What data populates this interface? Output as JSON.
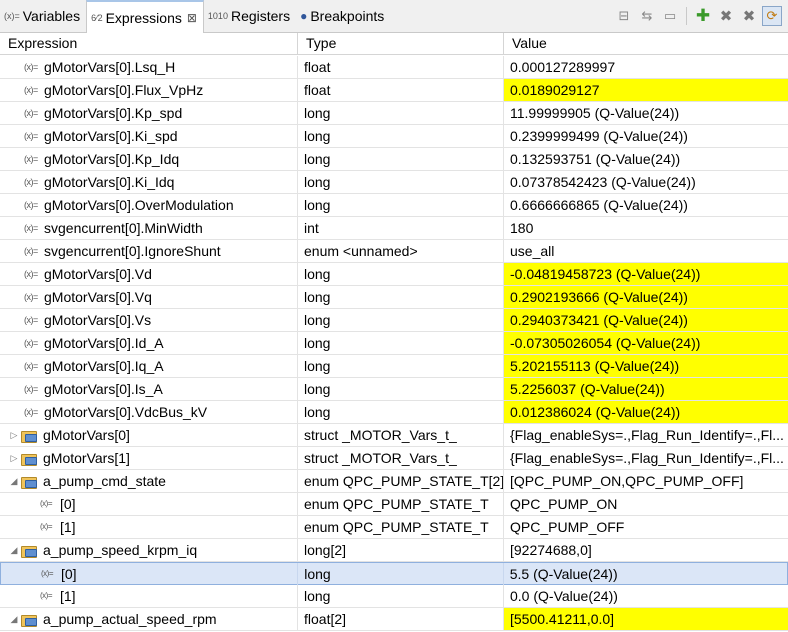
{
  "tabs": [
    {
      "label": "Variables",
      "icon": "variables-icon"
    },
    {
      "label": "Expressions",
      "icon": "expressions-icon",
      "active": true
    },
    {
      "label": "Registers",
      "icon": "registers-icon"
    },
    {
      "label": "Breakpoints",
      "icon": "breakpoints-icon"
    }
  ],
  "toolbar_icons": [
    "collapse-all-icon",
    "show-type-names-icon",
    "minimize-icon",
    "add-expression-icon",
    "remove-expression-icon",
    "remove-all-icon",
    "continuous-refresh-icon"
  ],
  "columns": {
    "expression": "Expression",
    "type": "Type",
    "value": "Value"
  },
  "highlight_color": "#ffff00",
  "rows": [
    {
      "expression": "gMotorVars[0].Lsq_H",
      "type": "float",
      "value": "0.000127289997",
      "highlight": false
    },
    {
      "expression": "gMotorVars[0].Flux_VpHz",
      "type": "float",
      "value": "0.0189029127",
      "highlight": true
    },
    {
      "expression": "gMotorVars[0].Kp_spd",
      "type": "long",
      "value": "11.99999905 (Q-Value(24))",
      "highlight": false
    },
    {
      "expression": "gMotorVars[0].Ki_spd",
      "type": "long",
      "value": "0.2399999499 (Q-Value(24))",
      "highlight": false
    },
    {
      "expression": "gMotorVars[0].Kp_Idq",
      "type": "long",
      "value": "0.132593751 (Q-Value(24))",
      "highlight": false
    },
    {
      "expression": "gMotorVars[0].Ki_Idq",
      "type": "long",
      "value": "0.07378542423 (Q-Value(24))",
      "highlight": false
    },
    {
      "expression": "gMotorVars[0].OverModulation",
      "type": "long",
      "value": "0.6666666865 (Q-Value(24))",
      "highlight": false
    },
    {
      "expression": "svgencurrent[0].MinWidth",
      "type": "int",
      "value": "180",
      "highlight": false
    },
    {
      "expression": "svgencurrent[0].IgnoreShunt",
      "type": "enum <unnamed>",
      "value": "use_all",
      "highlight": false
    },
    {
      "expression": "gMotorVars[0].Vd",
      "type": "long",
      "value": "-0.04819458723 (Q-Value(24))",
      "highlight": true
    },
    {
      "expression": "gMotorVars[0].Vq",
      "type": "long",
      "value": "0.2902193666 (Q-Value(24))",
      "highlight": true
    },
    {
      "expression": "gMotorVars[0].Vs",
      "type": "long",
      "value": "0.2940373421 (Q-Value(24))",
      "highlight": true
    },
    {
      "expression": "gMotorVars[0].Id_A",
      "type": "long",
      "value": "-0.07305026054 (Q-Value(24))",
      "highlight": true
    },
    {
      "expression": "gMotorVars[0].Iq_A",
      "type": "long",
      "value": "5.202155113 (Q-Value(24))",
      "highlight": true
    },
    {
      "expression": "gMotorVars[0].Is_A",
      "type": "long",
      "value": "5.2256037 (Q-Value(24))",
      "highlight": true
    },
    {
      "expression": "gMotorVars[0].VdcBus_kV",
      "type": "long",
      "value": "0.012386024 (Q-Value(24))",
      "highlight": true
    },
    {
      "expression": "gMotorVars[0]",
      "type": "struct _MOTOR_Vars_t_",
      "value": "{Flag_enableSys=.,Flag_Run_Identify=.,Fl...",
      "highlight": false,
      "kind": "struct",
      "expander": "collapsed"
    },
    {
      "expression": "gMotorVars[1]",
      "type": "struct _MOTOR_Vars_t_",
      "value": "{Flag_enableSys=.,Flag_Run_Identify=.,Fl...",
      "highlight": false,
      "kind": "struct",
      "expander": "collapsed"
    },
    {
      "expression": "a_pump_cmd_state",
      "type": "enum QPC_PUMP_STATE_T[2]",
      "value": "[QPC_PUMP_ON,QPC_PUMP_OFF]",
      "highlight": false,
      "kind": "struct",
      "expander": "expanded"
    },
    {
      "expression": "[0]",
      "type": "enum QPC_PUMP_STATE_T",
      "value": "QPC_PUMP_ON",
      "highlight": false,
      "kind": "child"
    },
    {
      "expression": "[1]",
      "type": "enum QPC_PUMP_STATE_T",
      "value": "QPC_PUMP_OFF",
      "highlight": false,
      "kind": "child"
    },
    {
      "expression": "a_pump_speed_krpm_iq",
      "type": "long[2]",
      "value": "[92274688,0]",
      "highlight": false,
      "kind": "struct",
      "expander": "expanded"
    },
    {
      "expression": "[0]",
      "type": "long",
      "value": "5.5 (Q-Value(24))",
      "highlight": false,
      "kind": "child",
      "selected": true
    },
    {
      "expression": "[1]",
      "type": "long",
      "value": "0.0 (Q-Value(24))",
      "highlight": false,
      "kind": "child"
    },
    {
      "expression": "a_pump_actual_speed_rpm",
      "type": "float[2]",
      "value": "[5500.41211,0.0]",
      "highlight": true,
      "kind": "struct",
      "expander": "expanded"
    }
  ]
}
